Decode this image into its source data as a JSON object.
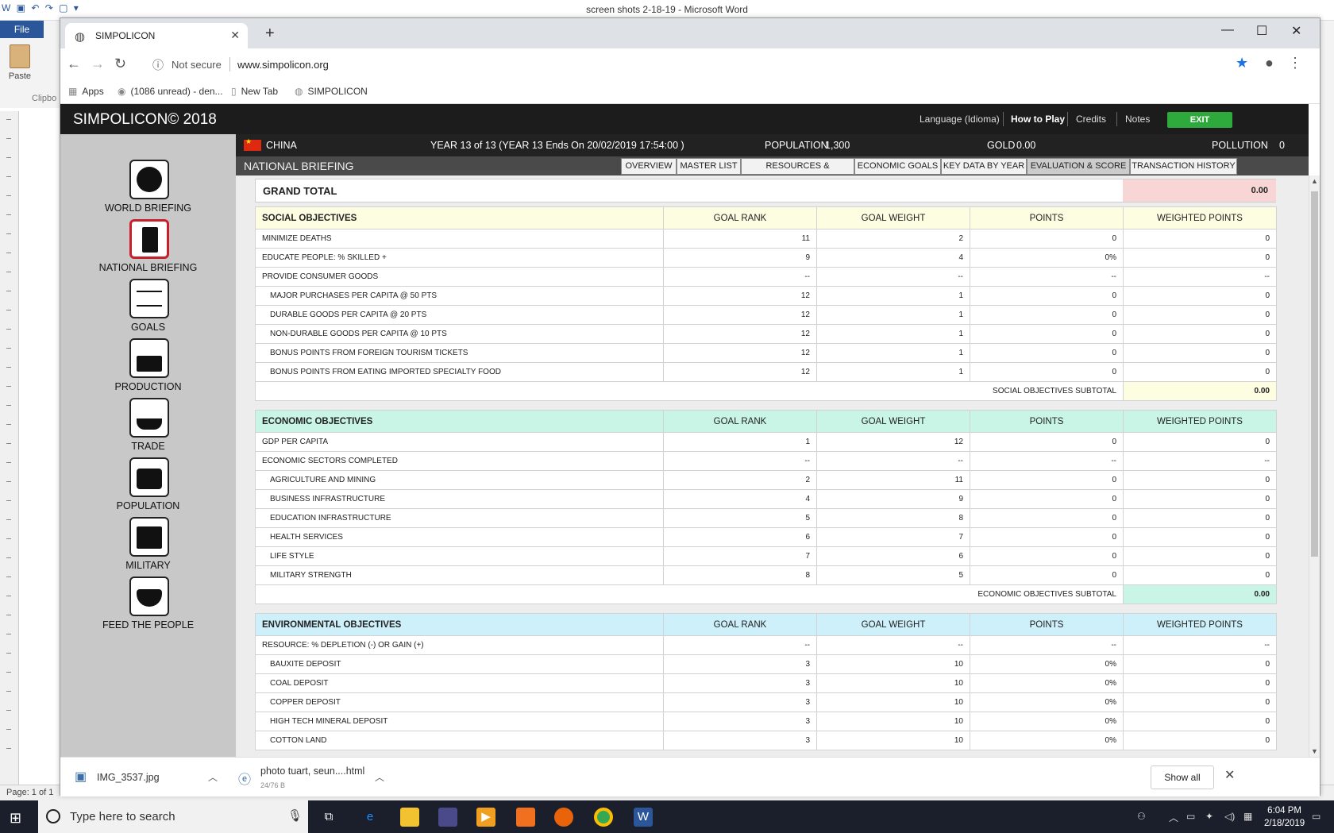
{
  "word": {
    "title": "screen shots 2-18-19  -  Microsoft Word",
    "file_tab": "File",
    "paste": "Paste",
    "clipboard": "Clipbo",
    "page": "Page: 1 of 1"
  },
  "browser": {
    "tab_title": "SIMPOLICON",
    "security": "Not secure",
    "url": "www.simpolicon.org",
    "bookmarks": [
      "Apps",
      "(1086 unread) - den...",
      "New Tab",
      "SIMPOLICON"
    ]
  },
  "app": {
    "title": "SIMPOLICON© 2018",
    "header_nav": [
      "Language (Idioma)",
      "How to Play",
      "Credits",
      "Notes"
    ],
    "exit_label": "EXIT",
    "sidebar": [
      "WORLD BRIEFING",
      "NATIONAL BRIEFING",
      "GOALS",
      "PRODUCTION",
      "TRADE",
      "POPULATION",
      "MILITARY",
      "FEED THE PEOPLE"
    ],
    "info": {
      "country": "CHINA",
      "year": "YEAR  13 of 13  (YEAR 13 Ends On 20/02/2019 17:54:00 )",
      "population_label": "POPULATION",
      "population": "1,300",
      "gold_label": "GOLD",
      "gold": "0.00",
      "pollution_label": "POLLUTION",
      "pollution": "0"
    },
    "briefing_title": "NATIONAL BRIEFING",
    "tabs": [
      "OVERVIEW",
      "MASTER LIST",
      "RESOURCES & PRODUCTS",
      "ECONOMIC GOALS",
      "KEY DATA BY YEAR",
      "EVALUATION & SCORE",
      "TRANSACTION HISTORY"
    ],
    "active_tab": "EVALUATION & SCORE",
    "grand_total": {
      "label": "GRAND TOTAL",
      "value": "0.00"
    },
    "columns": [
      "GOAL RANK",
      "GOAL WEIGHT",
      "POINTS",
      "WEIGHTED POINTS"
    ],
    "social": {
      "title": "SOCIAL OBJECTIVES",
      "rows": [
        [
          "MINIMIZE DEATHS",
          "11",
          "2",
          "0",
          "0"
        ],
        [
          "EDUCATE PEOPLE: % SKILLED +",
          "9",
          "4",
          "0%",
          "0"
        ],
        [
          "PROVIDE CONSUMER GOODS",
          "--",
          "--",
          "--",
          "--"
        ],
        [
          "MAJOR PURCHASES PER CAPITA @ 50 PTS",
          "12",
          "1",
          "0",
          "0"
        ],
        [
          "DURABLE GOODS PER CAPITA @ 20 PTS",
          "12",
          "1",
          "0",
          "0"
        ],
        [
          "NON-DURABLE GOODS PER CAPITA @ 10 PTS",
          "12",
          "1",
          "0",
          "0"
        ],
        [
          "BONUS POINTS FROM FOREIGN TOURISM TICKETS",
          "12",
          "1",
          "0",
          "0"
        ],
        [
          "BONUS POINTS FROM EATING IMPORTED SPECIALTY FOOD",
          "12",
          "1",
          "0",
          "0"
        ]
      ],
      "subtotal_label": "SOCIAL OBJECTIVES SUBTOTAL",
      "subtotal": "0.00"
    },
    "economic": {
      "title": "ECONOMIC OBJECTIVES",
      "rows": [
        [
          "GDP PER CAPITA",
          "1",
          "12",
          "0",
          "0"
        ],
        [
          "ECONOMIC SECTORS COMPLETED",
          "--",
          "--",
          "--",
          "--"
        ],
        [
          "AGRICULTURE AND MINING",
          "2",
          "11",
          "0",
          "0"
        ],
        [
          "BUSINESS INFRASTRUCTURE",
          "4",
          "9",
          "0",
          "0"
        ],
        [
          "EDUCATION INFRASTRUCTURE",
          "5",
          "8",
          "0",
          "0"
        ],
        [
          "HEALTH SERVICES",
          "6",
          "7",
          "0",
          "0"
        ],
        [
          "LIFE STYLE",
          "7",
          "6",
          "0",
          "0"
        ],
        [
          "MILITARY STRENGTH",
          "8",
          "5",
          "0",
          "0"
        ]
      ],
      "subtotal_label": "ECONOMIC OBJECTIVES SUBTOTAL",
      "subtotal": "0.00"
    },
    "environmental": {
      "title": "ENVIRONMENTAL OBJECTIVES",
      "rows": [
        [
          "RESOURCE: % DEPLETION (-) OR GAIN (+)",
          "--",
          "--",
          "--",
          "--"
        ],
        [
          "BAUXITE DEPOSIT",
          "3",
          "10",
          "0%",
          "0"
        ],
        [
          "COAL DEPOSIT",
          "3",
          "10",
          "0%",
          "0"
        ],
        [
          "COPPER DEPOSIT",
          "3",
          "10",
          "0%",
          "0"
        ],
        [
          "HIGH TECH MINERAL DEPOSIT",
          "3",
          "10",
          "0%",
          "0"
        ],
        [
          "COTTON LAND",
          "3",
          "10",
          "0%",
          "0"
        ]
      ]
    }
  },
  "downloads": {
    "items": [
      {
        "name": "IMG_3537.jpg",
        "size": ""
      },
      {
        "name": "photo tuart, seun....html",
        "size": "24/76 B"
      }
    ],
    "show_all": "Show all"
  },
  "taskbar": {
    "search_placeholder": "Type here to search",
    "time": "6:04 PM",
    "date": "2/18/2019"
  }
}
